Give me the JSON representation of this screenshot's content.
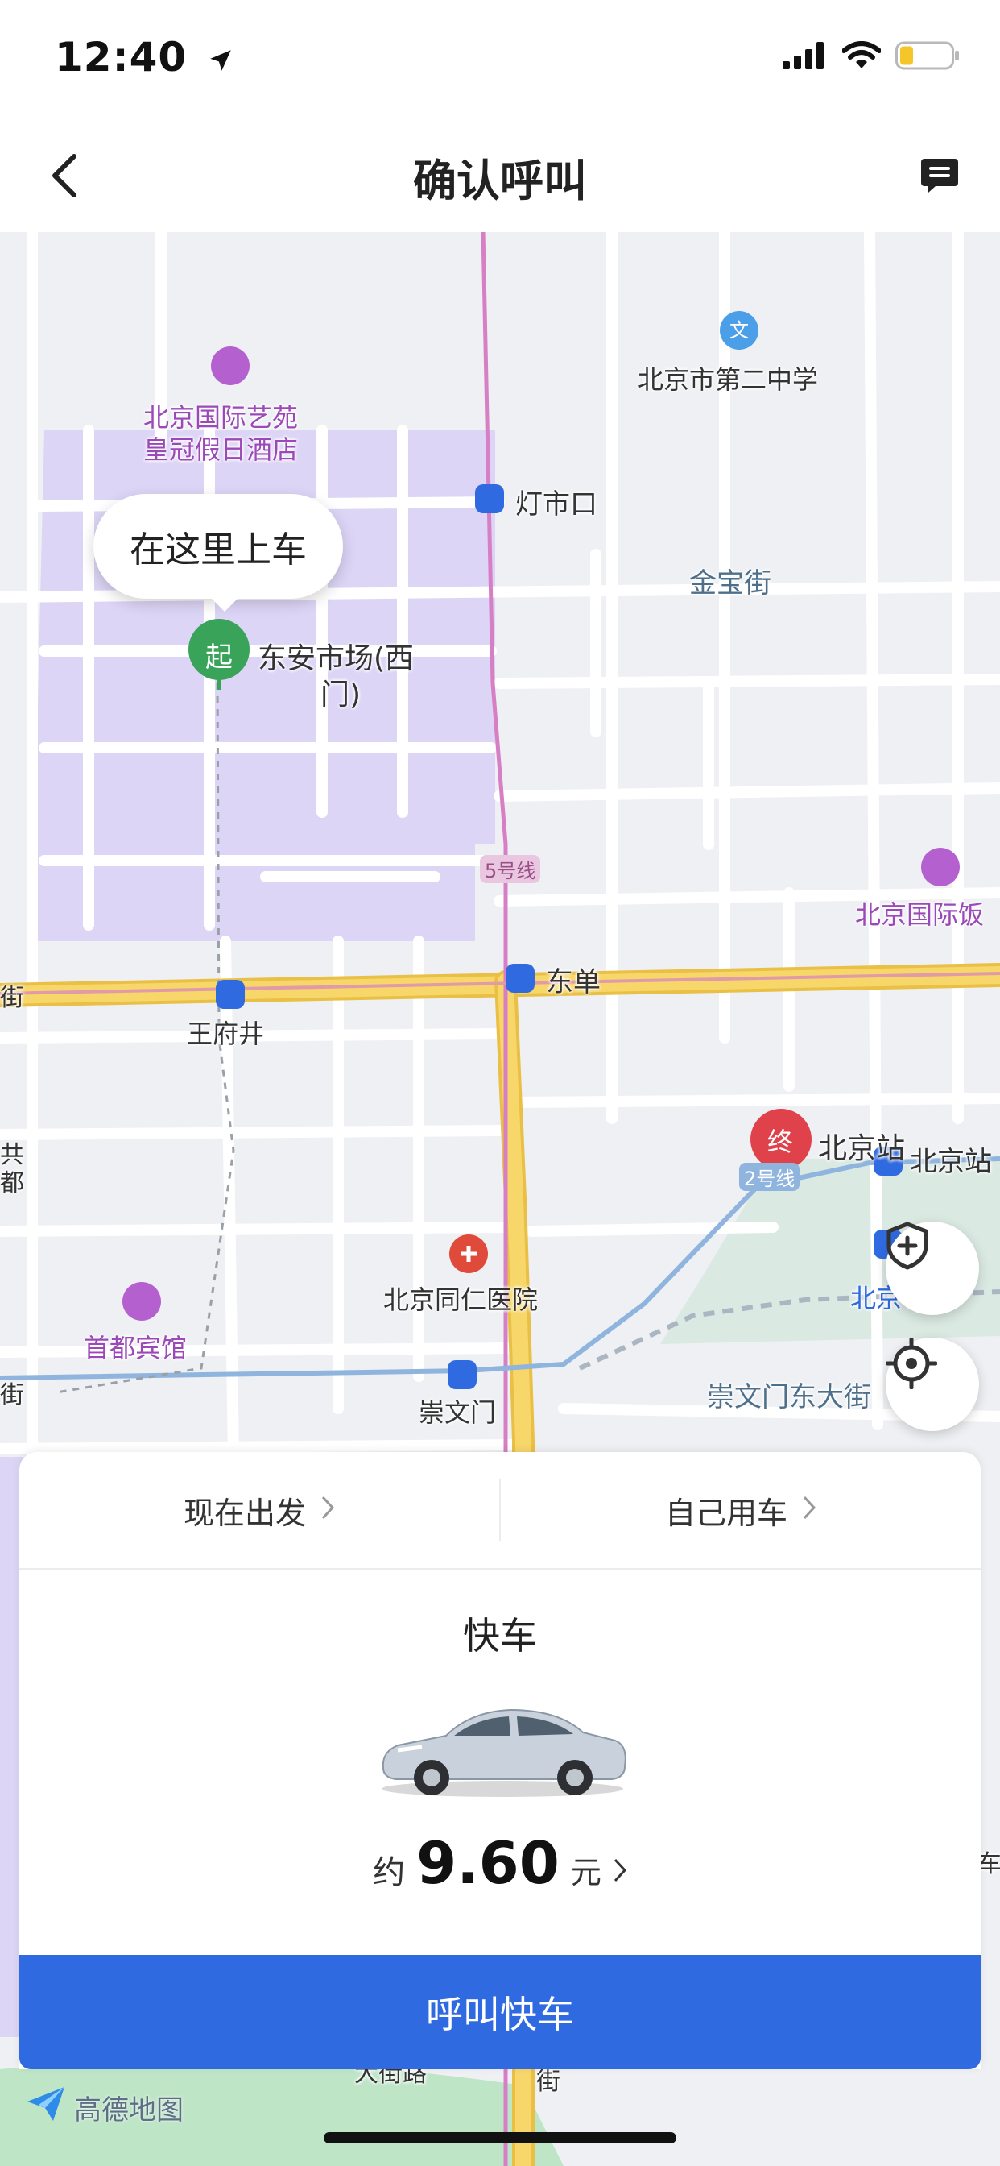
{
  "status_bar": {
    "time": "12:40"
  },
  "nav": {
    "title": "确认呼叫"
  },
  "map": {
    "pickup_bubble": "在这里上车",
    "start_marker": "起",
    "end_marker": "终",
    "labels": {
      "hotel1_line1": "北京国际艺苑",
      "hotel1_line2": "皇冠假日酒店",
      "school": "北京市第二中学",
      "dengshikou": "灯市口",
      "jinbaojie": "金宝街",
      "start_place_line1": "东安市场(西",
      "start_place_line2": "门)",
      "line5": "5号线",
      "hotel_right": "北京国际饭",
      "wangfujing": "王府井",
      "dongdan": "东单",
      "jie_left": "街",
      "gong_left": "共",
      "du_left": "都",
      "beijingzhan": "北京站",
      "beijingzhan_metro": "北京站",
      "line2": "2号线",
      "beijing_small": "北京",
      "hospital": "北京同仁医院",
      "shoudu_hotel": "首都宾馆",
      "chongwenmen": "崇文门",
      "chongwenmen_street": "崇文门东大街",
      "jie_left2": "街",
      "jie_bottom": "街",
      "road_bottom": "大街路",
      "right_edge": "车福"
    },
    "logo": "高德地图"
  },
  "panel": {
    "option_left": "现在出发",
    "option_right": "自己用车",
    "service_name": "快车",
    "price_prefix": "约",
    "price_value": "9.60",
    "price_unit": "元",
    "call_button": "呼叫快车"
  },
  "colors": {
    "primary": "#2f6ae0",
    "pickup_green": "#3aa35a",
    "dest_red": "#e0424b",
    "area_purple": "#ddd5f6",
    "main_road": "#f7d66a"
  }
}
